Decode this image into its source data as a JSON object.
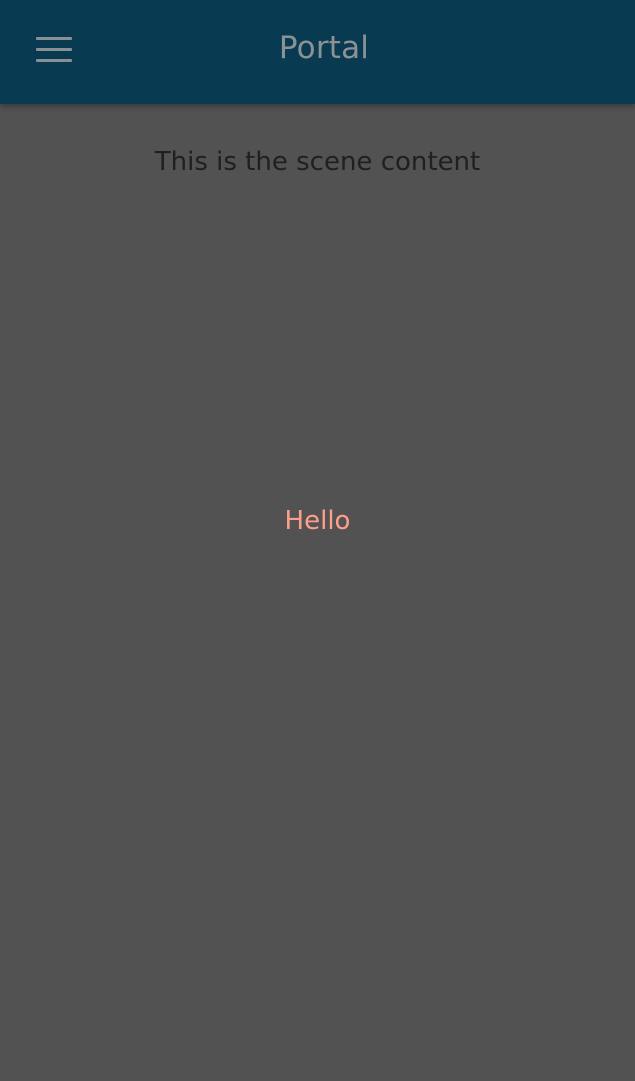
{
  "header": {
    "title": "Portal",
    "menu_icon": "hamburger-menu-icon",
    "background": "#083a51"
  },
  "main": {
    "scene_text": "This is the scene content",
    "hello_text": "Hello",
    "background": "#525252",
    "hello_color": "#ff9e8c"
  }
}
